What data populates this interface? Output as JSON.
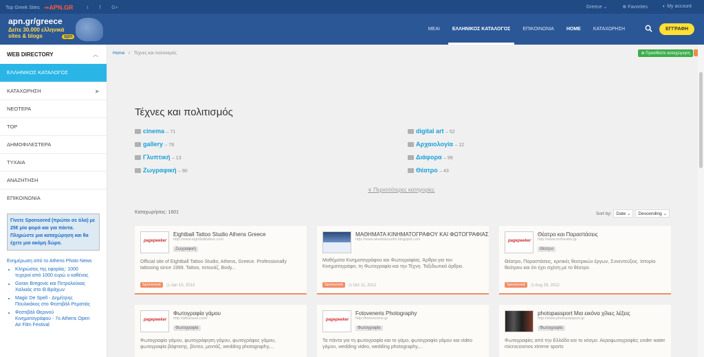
{
  "topbar": {
    "greek_sites": "Top Greek Sites",
    "apn": "⇒APN.GR",
    "social": [
      "t",
      "f",
      "G+"
    ],
    "country": "Greece ⌄",
    "favorites": "⊕ Favorites",
    "account": "◐ My account"
  },
  "logo": {
    "line1": "apn.gr/greece",
    "line2": "Δείτε 30.000 ελληνικά sites & blogs",
    "badge": "apn"
  },
  "nav": {
    "items": [
      {
        "label": "ΜΕΑΙ",
        "active": false
      },
      {
        "label": "ΕΛΛΗΝΙΚΟΣ ΚΑΤΑΛΟΓΟΣ",
        "active": true
      },
      {
        "label": "ΕΠΙΚΟΙΝΩΝΙΑ",
        "active": false
      },
      {
        "label": "HOME",
        "active": false
      },
      {
        "label": "ΚΑΤΑΧΩΡΗΣΗ",
        "active": false
      }
    ],
    "register": "ΕΓΓΡΑΦΗ"
  },
  "sidebar": {
    "heading": "WEB DIRECTORY",
    "items": [
      "ΕΛΛΗΝΙΚΟΣ ΚΑΤΑΛΟΓΟΣ",
      "ΚΑΤΑΧΩΡΗΣΗ",
      "ΝΕΟΤΕΡΑ",
      "TOP",
      "ΔΗΜΟΦΙΛΕΣΤΕΡΑ",
      "ΤΥΧΑΙΑ",
      "ΑΝΑΖΗΤΗΣΗ",
      "ΕΠΙΚΟΙΝΩΝΙΑ"
    ],
    "promo": "Γίνετε Sponsored (πρώτοι σε όλα) με 25€ μία φορά και για πάντα. Πληρώστε μια καταχώρηση και θα έχετε μια ακόμη δώρο.",
    "feed_title": "Ενημέρωση από το Athens Photo News",
    "feed": [
      "Κληρώσεις της εφορίας: 1000 τυχεροί από 1000 ευρώ ο καθένας",
      "Goran Bregovic και Πετρολούκας Χαλκιάς στο Θ.Βράχων",
      "Magic De Spell - Δημήτρης Πουλικάκος στο Φεστιβάλ Ρεματιάς",
      "Φεστιβάλ Θερινού Κινηματογράφου - 7o Athens Open Air Film Festival"
    ]
  },
  "breadcrumb": {
    "home": "Home",
    "sep": "/",
    "current": "Τέχνες και πολιτισμός"
  },
  "add_button": "⊕ Προσθέστε καταχώρηση",
  "page_title": "Τέχνες και πολιτισμός",
  "categories": [
    {
      "name": "cinema",
      "count": "– 71"
    },
    {
      "name": "gallery",
      "count": "– 78"
    },
    {
      "name": "Γλυπτική",
      "count": "– 13"
    },
    {
      "name": "Ζωγραφική",
      "count": "– 90"
    },
    {
      "name": "digital art",
      "count": "– 52"
    },
    {
      "name": "Αρχαιολογία",
      "count": "– 12"
    },
    {
      "name": "Διάφορα",
      "count": "– 99"
    },
    {
      "name": "Θέατρο",
      "count": "– 43"
    }
  ],
  "more_categories": "∨ Περισσότερες κατηγορίες",
  "listing_count": "Καταχωρήσεις: 1601",
  "sort": {
    "label": "Sort by:",
    "field": "Date ⌄",
    "order": "Descending ⌄"
  },
  "listings": [
    {
      "title": "Eightball Tattoo Studio Athens Greece",
      "url": "http://www.eightballtattoo.com",
      "tag": "Ζωγραφική",
      "desc": "Official site of Eightball Tattoo Studio, Athens, Greece. Professionally tattooing since 1999. Tattoo, τατουάζ, Body...",
      "sponsored": "Sponsored",
      "date": "◷ Jan 10, 2013",
      "thumb": "pagepeeker"
    },
    {
      "title": "ΜΑΘΗΜΑΤΑ ΚΙΝΗΜΑΤΟΓΡΑΦΟΥ ΚΑΙ ΦΩΤΟΓΡΑΦΙΑΣ",
      "url": "http://www.akadiskouofis.blogspot.com",
      "tag": "",
      "desc": "Μαθήματα Κινηματογράφου και Φωτογραφίας. Άρθρα για τον Κινηματογράφο, τη Φωτογραφία και την Τέχνη. Ταξιδιωτικά άρθρα.",
      "sponsored": "Sponsored",
      "date": "◷ Oct 11, 2012",
      "thumb": "photo"
    },
    {
      "title": "Θέατρο και Παραστάσεις",
      "url": "http://www.mrtheatre.gr",
      "tag": "Θέατρο",
      "desc": "Θέατρο, Παραστάσεις, κριτικές θεατρικών έργων, Συνεντεύξεις. Ιστορία θεάτρου και ότι έχει σχέση με το θέατρο.",
      "sponsored": "Sponsored",
      "date": "◷ Aug 29, 2012",
      "thumb": "pagepeeker"
    },
    {
      "title": "Φωτογραφία γάμου",
      "url": "http://athanaos.com/",
      "tag": "Φωτογραφία",
      "desc": "Φωτογραφία γάμου, φωτογράφηση γάμου, φωτογράφος γάμου, φωτογραφία βάφτισης, βίντεο, μοντάζ, wedding photography,...",
      "sponsored": "",
      "date": "",
      "thumb": "pagepeeker"
    },
    {
      "title": "Fotoveneris Photography",
      "url": "http://fotoveneris.gr",
      "tag": "Φωτογραφία",
      "desc": "Τα πάντα για τη φωτογραφία και το γάμο, φωτογραφία γάμου και video γάμου, wedding video, wedding photography,...",
      "sponsored": "",
      "date": "",
      "thumb": "pagepeeker"
    },
    {
      "title": "photopassport Μια εικόνα χίλιες λέξεις",
      "url": "http://www.photopassport.gr",
      "tag": "Φωτογραφία",
      "desc": "Φωτογραφίες από την Ελλάδα και το κόσμο. Αεροφωτογραφίες under water microcosmos xtreme sports",
      "sponsored": "",
      "date": "",
      "thumb": "dark"
    }
  ],
  "thumb_label": "pagepeeker"
}
